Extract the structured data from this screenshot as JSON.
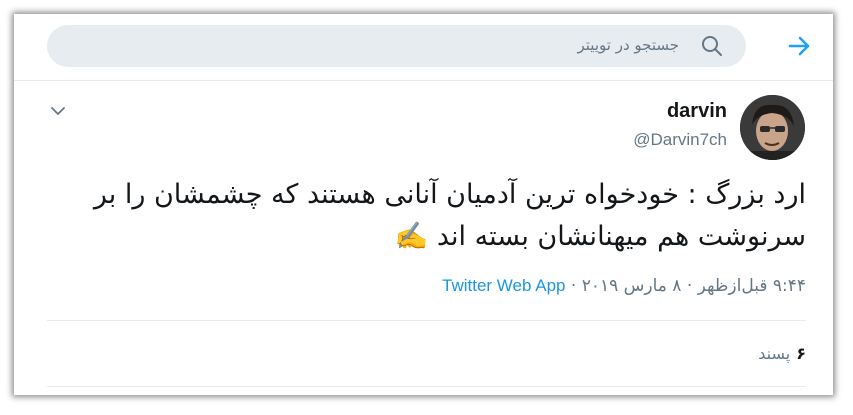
{
  "search": {
    "placeholder": "جستجو در توییتر"
  },
  "icons": {
    "back": "arrow-right-icon",
    "search": "search-icon",
    "more": "chevron-down-icon"
  },
  "colors": {
    "accent": "#1da1f2",
    "link": "#1b95e0",
    "muted": "#657786",
    "text": "#14171a"
  },
  "tweet": {
    "author_name": "darvin",
    "author_handle": "@Darvin7ch",
    "text": "ارد بزرگ : خودخواه ترین آدمیان آنانی هستند که چشمشان را بر سرنوشت هم میهنانشان بسته اند ✍️",
    "time": "۹:۴۴ قبل‌ازظهر",
    "date": "۸ مارس ۲۰۱۹",
    "separator": "·",
    "source": "Twitter Web App",
    "likes_count": "۶",
    "likes_label": "پسند"
  }
}
